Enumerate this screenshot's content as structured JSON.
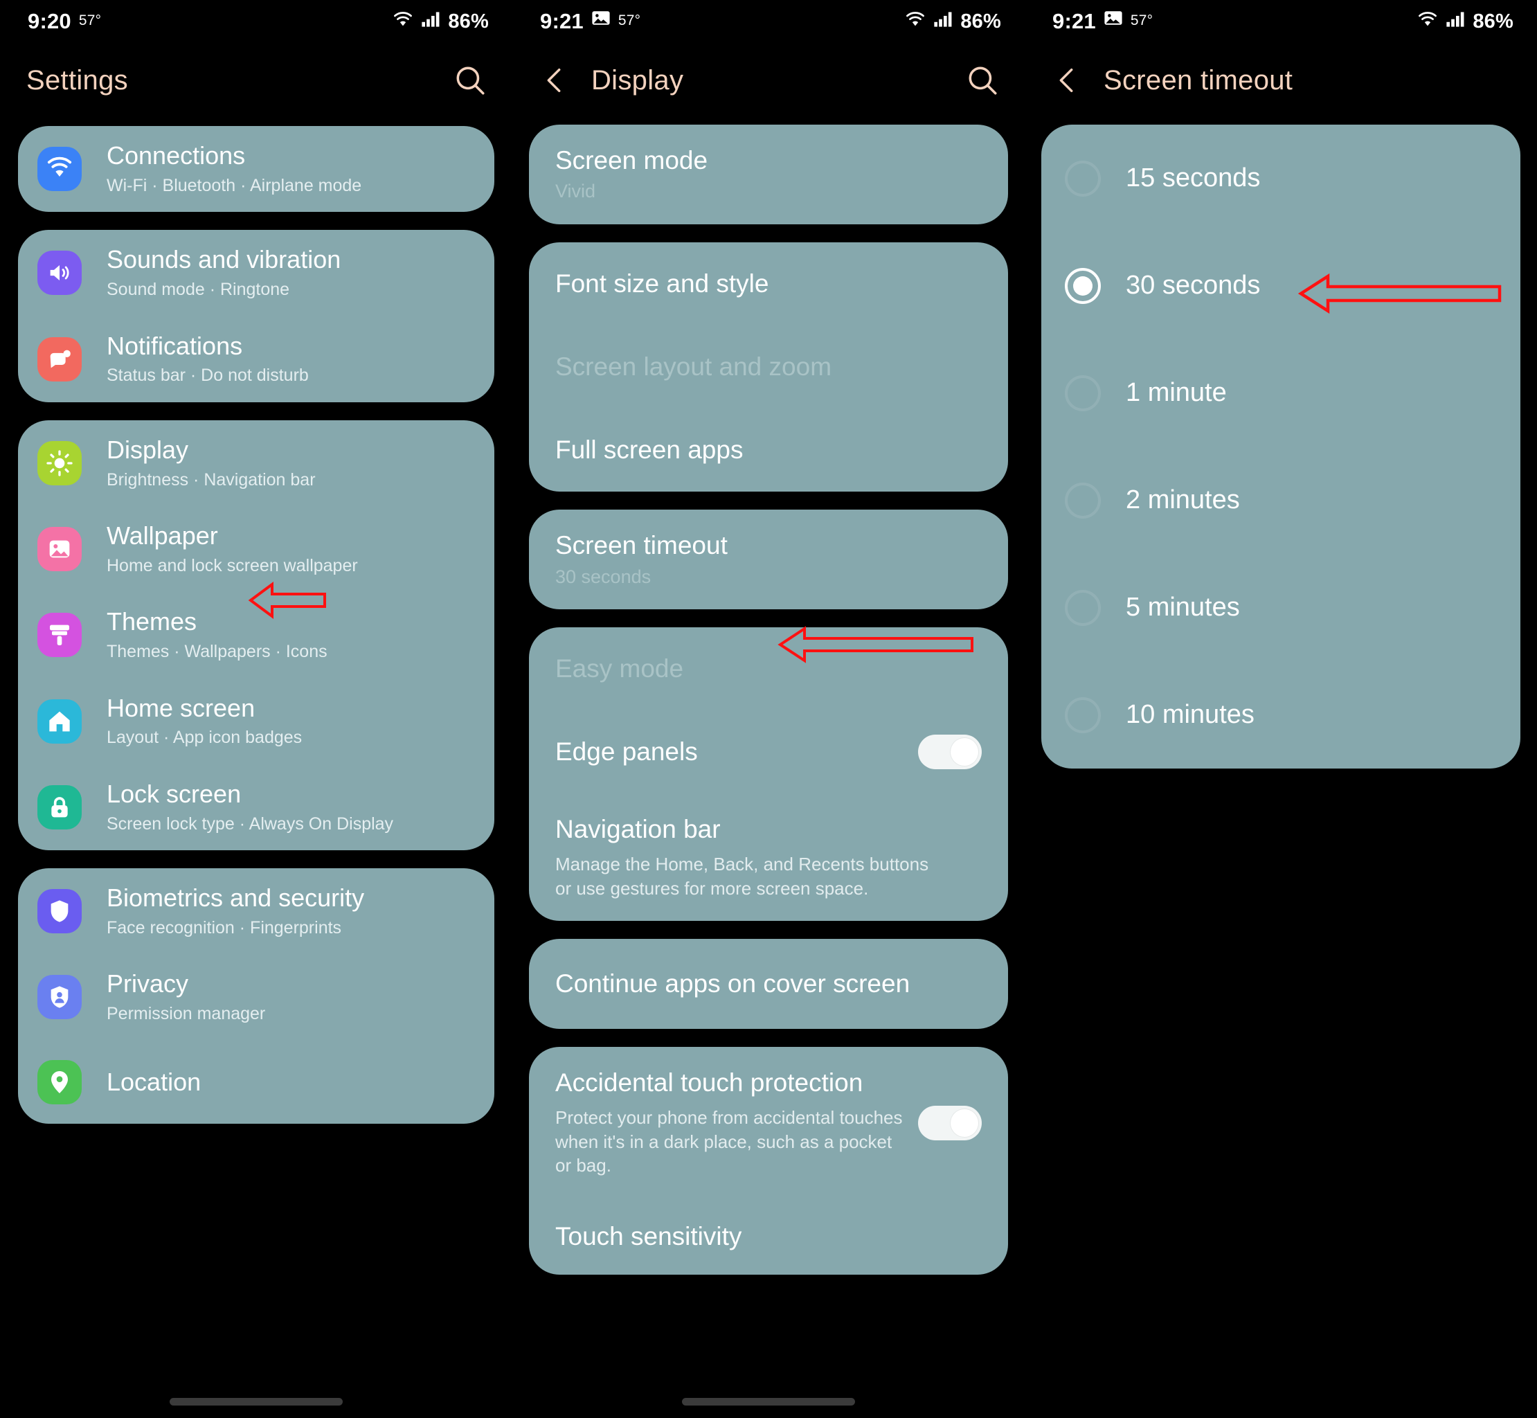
{
  "meta": {
    "card_color": "#86a8ad",
    "background_color": "#000000",
    "header_text_color": "#f3d2be",
    "annotation_color": "#ff0000"
  },
  "panels": [
    {
      "id": "settings",
      "status": {
        "time": "9:20",
        "temp": "57°",
        "battery": "86%",
        "icons": [
          "wifi-icon",
          "signal-icon"
        ]
      },
      "header": {
        "title": "Settings",
        "back": false,
        "search": true
      },
      "groups": [
        {
          "items": [
            {
              "title": "Connections",
              "subtitle": "Wi-Fi  ·  Bluetooth  ·  Airplane mode",
              "icon": "wifi-icon",
              "icon_color": "#3b82f6"
            }
          ]
        },
        {
          "items": [
            {
              "title": "Sounds and vibration",
              "subtitle": "Sound mode  ·  Ringtone",
              "icon": "volume-icon",
              "icon_color": "#7c5cf0"
            },
            {
              "title": "Notifications",
              "subtitle": "Status bar  ·  Do not disturb",
              "icon": "notification-icon",
              "icon_color": "#f2695f"
            }
          ]
        },
        {
          "items": [
            {
              "title": "Display",
              "subtitle": "Brightness  ·  Navigation bar",
              "icon": "brightness-icon",
              "icon_color": "#a8d431"
            },
            {
              "title": "Wallpaper",
              "subtitle": "Home and lock screen wallpaper",
              "icon": "image-icon",
              "icon_color": "#f472a6"
            },
            {
              "title": "Themes",
              "subtitle": "Themes  ·  Wallpapers  ·  Icons",
              "icon": "paintbrush-icon",
              "icon_color": "#d452e0"
            },
            {
              "title": "Home screen",
              "subtitle": "Layout  ·  App icon badges",
              "icon": "home-icon",
              "icon_color": "#2bb8d9"
            },
            {
              "title": "Lock screen",
              "subtitle": "Screen lock type  ·  Always On Display",
              "icon": "lock-icon",
              "icon_color": "#1fb894"
            }
          ]
        },
        {
          "items": [
            {
              "title": "Biometrics and security",
              "subtitle": "Face recognition  ·  Fingerprints",
              "icon": "shield-icon",
              "icon_color": "#6a5df0"
            },
            {
              "title": "Privacy",
              "subtitle": "Permission manager",
              "icon": "privacy-shield-icon",
              "icon_color": "#6a80f0"
            },
            {
              "title": "Location",
              "subtitle": "",
              "icon": "location-pin-icon",
              "icon_color": "#4cc254"
            }
          ]
        }
      ]
    },
    {
      "id": "display",
      "status": {
        "time": "9:21",
        "temp": "57°",
        "battery": "86%",
        "icons": [
          "picture-icon",
          "wifi-icon",
          "signal-icon"
        ]
      },
      "header": {
        "title": "Display",
        "back": true,
        "search": true
      },
      "groups": [
        {
          "items": [
            {
              "title": "Screen mode",
              "subtitle": "Vivid",
              "dim_title": false
            }
          ]
        },
        {
          "items": [
            {
              "title": "Font size and style",
              "subtitle": "",
              "dim_title": false
            },
            {
              "title": "Screen layout and zoom",
              "subtitle": "",
              "dim_title": true
            },
            {
              "title": "Full screen apps",
              "subtitle": "",
              "dim_title": false
            }
          ]
        },
        {
          "items": [
            {
              "title": "Screen timeout",
              "subtitle": "30 seconds",
              "dim_title": false
            }
          ]
        },
        {
          "items": [
            {
              "title": "Easy mode",
              "subtitle": "",
              "dim_title": true
            },
            {
              "title": "Edge panels",
              "subtitle": "",
              "dim_title": false,
              "toggle": "on"
            },
            {
              "title": "Navigation bar",
              "subtitle": "",
              "dim_title": false,
              "description": "Manage the Home, Back, and Recents buttons or use gestures for more screen space."
            }
          ]
        },
        {
          "items": [
            {
              "title": "Continue apps on cover screen",
              "subtitle": "",
              "dim_title": false
            }
          ]
        },
        {
          "items": [
            {
              "title": "Accidental touch protection",
              "subtitle": "",
              "dim_title": false,
              "toggle": "on",
              "description": "Protect your phone from accidental touches when it's in a dark place, such as a pocket or bag."
            },
            {
              "title": "Touch sensitivity",
              "subtitle": "",
              "dim_title": false
            }
          ]
        }
      ]
    },
    {
      "id": "timeout",
      "status": {
        "time": "9:21",
        "temp": "57°",
        "battery": "86%",
        "icons": [
          "picture-icon",
          "wifi-icon",
          "signal-icon"
        ]
      },
      "header": {
        "title": "Screen timeout",
        "back": true,
        "search": false
      },
      "options": [
        {
          "label": "15 seconds",
          "selected": false
        },
        {
          "label": "30 seconds",
          "selected": true
        },
        {
          "label": "1 minute",
          "selected": false
        },
        {
          "label": "2 minutes",
          "selected": false
        },
        {
          "label": "5 minutes",
          "selected": false
        },
        {
          "label": "10 minutes",
          "selected": false
        }
      ]
    }
  ],
  "annotations": [
    {
      "name": "arrow-to-display",
      "target": "Display"
    },
    {
      "name": "arrow-to-screen-timeout",
      "target": "Screen timeout"
    },
    {
      "name": "arrow-to-30-seconds",
      "target": "30 seconds"
    }
  ]
}
